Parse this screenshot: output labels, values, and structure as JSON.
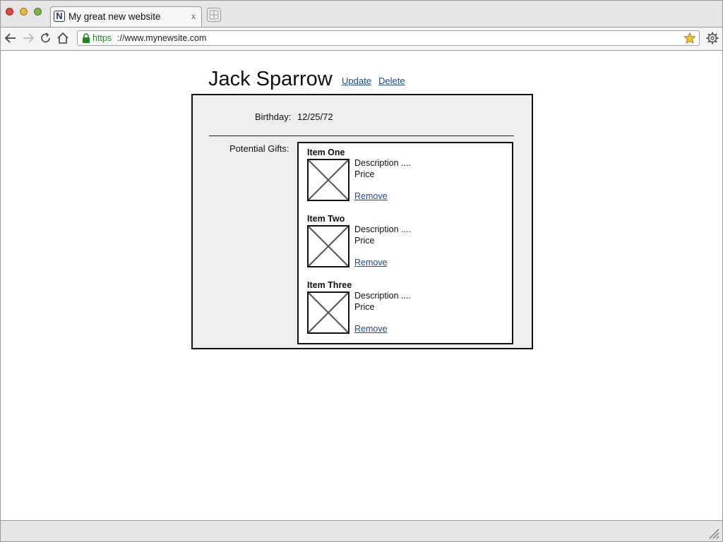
{
  "browser": {
    "tab": {
      "favicon_letter": "N",
      "title": "My great new website",
      "close": "x"
    },
    "url": {
      "scheme": "https",
      "rest": "://www.mynewsite.com"
    }
  },
  "page": {
    "name": "Jack Sparrow",
    "update_link": "Update",
    "delete_link": "Delete",
    "birthday_label": "Birthday:",
    "birthday_value": "12/25/72",
    "gifts_label": "Potential Gifts:",
    "gifts": [
      {
        "title": "Item One",
        "description": "Description ....",
        "price": "Price",
        "remove": "Remove"
      },
      {
        "title": "Item Two",
        "description": "Description ....",
        "price": "Price",
        "remove": "Remove"
      },
      {
        "title": "Item Three",
        "description": "Description ....",
        "price": "Price",
        "remove": "Remove"
      }
    ]
  },
  "colors": {
    "link": "#1a4a9c",
    "https": "#1c8b1c",
    "card_bg": "#eeeeee"
  },
  "icons": [
    "back-arrow-icon",
    "forward-arrow-icon",
    "reload-icon",
    "home-icon",
    "lock-icon",
    "bookmark-star-icon",
    "settings-gear-icon",
    "new-tab-icon",
    "image-placeholder-icon",
    "resize-grip-icon"
  ]
}
